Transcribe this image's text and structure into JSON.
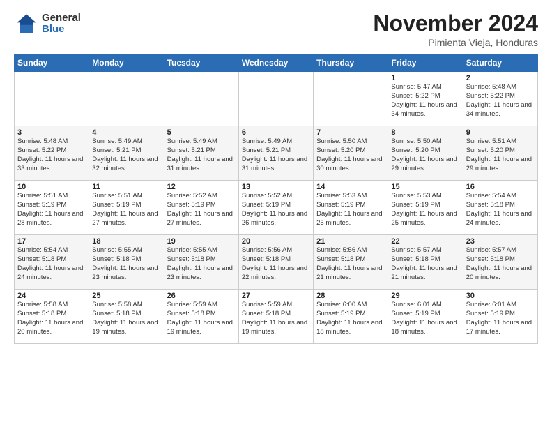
{
  "header": {
    "logo_general": "General",
    "logo_blue": "Blue",
    "month": "November 2024",
    "location": "Pimienta Vieja, Honduras"
  },
  "days_of_week": [
    "Sunday",
    "Monday",
    "Tuesday",
    "Wednesday",
    "Thursday",
    "Friday",
    "Saturday"
  ],
  "weeks": [
    [
      {
        "day": "",
        "sunrise": "",
        "sunset": "",
        "daylight": ""
      },
      {
        "day": "",
        "sunrise": "",
        "sunset": "",
        "daylight": ""
      },
      {
        "day": "",
        "sunrise": "",
        "sunset": "",
        "daylight": ""
      },
      {
        "day": "",
        "sunrise": "",
        "sunset": "",
        "daylight": ""
      },
      {
        "day": "",
        "sunrise": "",
        "sunset": "",
        "daylight": ""
      },
      {
        "day": "1",
        "sunrise": "Sunrise: 5:47 AM",
        "sunset": "Sunset: 5:22 PM",
        "daylight": "Daylight: 11 hours and 34 minutes."
      },
      {
        "day": "2",
        "sunrise": "Sunrise: 5:48 AM",
        "sunset": "Sunset: 5:22 PM",
        "daylight": "Daylight: 11 hours and 34 minutes."
      }
    ],
    [
      {
        "day": "3",
        "sunrise": "Sunrise: 5:48 AM",
        "sunset": "Sunset: 5:22 PM",
        "daylight": "Daylight: 11 hours and 33 minutes."
      },
      {
        "day": "4",
        "sunrise": "Sunrise: 5:49 AM",
        "sunset": "Sunset: 5:21 PM",
        "daylight": "Daylight: 11 hours and 32 minutes."
      },
      {
        "day": "5",
        "sunrise": "Sunrise: 5:49 AM",
        "sunset": "Sunset: 5:21 PM",
        "daylight": "Daylight: 11 hours and 31 minutes."
      },
      {
        "day": "6",
        "sunrise": "Sunrise: 5:49 AM",
        "sunset": "Sunset: 5:21 PM",
        "daylight": "Daylight: 11 hours and 31 minutes."
      },
      {
        "day": "7",
        "sunrise": "Sunrise: 5:50 AM",
        "sunset": "Sunset: 5:20 PM",
        "daylight": "Daylight: 11 hours and 30 minutes."
      },
      {
        "day": "8",
        "sunrise": "Sunrise: 5:50 AM",
        "sunset": "Sunset: 5:20 PM",
        "daylight": "Daylight: 11 hours and 29 minutes."
      },
      {
        "day": "9",
        "sunrise": "Sunrise: 5:51 AM",
        "sunset": "Sunset: 5:20 PM",
        "daylight": "Daylight: 11 hours and 29 minutes."
      }
    ],
    [
      {
        "day": "10",
        "sunrise": "Sunrise: 5:51 AM",
        "sunset": "Sunset: 5:19 PM",
        "daylight": "Daylight: 11 hours and 28 minutes."
      },
      {
        "day": "11",
        "sunrise": "Sunrise: 5:51 AM",
        "sunset": "Sunset: 5:19 PM",
        "daylight": "Daylight: 11 hours and 27 minutes."
      },
      {
        "day": "12",
        "sunrise": "Sunrise: 5:52 AM",
        "sunset": "Sunset: 5:19 PM",
        "daylight": "Daylight: 11 hours and 27 minutes."
      },
      {
        "day": "13",
        "sunrise": "Sunrise: 5:52 AM",
        "sunset": "Sunset: 5:19 PM",
        "daylight": "Daylight: 11 hours and 26 minutes."
      },
      {
        "day": "14",
        "sunrise": "Sunrise: 5:53 AM",
        "sunset": "Sunset: 5:19 PM",
        "daylight": "Daylight: 11 hours and 25 minutes."
      },
      {
        "day": "15",
        "sunrise": "Sunrise: 5:53 AM",
        "sunset": "Sunset: 5:19 PM",
        "daylight": "Daylight: 11 hours and 25 minutes."
      },
      {
        "day": "16",
        "sunrise": "Sunrise: 5:54 AM",
        "sunset": "Sunset: 5:18 PM",
        "daylight": "Daylight: 11 hours and 24 minutes."
      }
    ],
    [
      {
        "day": "17",
        "sunrise": "Sunrise: 5:54 AM",
        "sunset": "Sunset: 5:18 PM",
        "daylight": "Daylight: 11 hours and 24 minutes."
      },
      {
        "day": "18",
        "sunrise": "Sunrise: 5:55 AM",
        "sunset": "Sunset: 5:18 PM",
        "daylight": "Daylight: 11 hours and 23 minutes."
      },
      {
        "day": "19",
        "sunrise": "Sunrise: 5:55 AM",
        "sunset": "Sunset: 5:18 PM",
        "daylight": "Daylight: 11 hours and 23 minutes."
      },
      {
        "day": "20",
        "sunrise": "Sunrise: 5:56 AM",
        "sunset": "Sunset: 5:18 PM",
        "daylight": "Daylight: 11 hours and 22 minutes."
      },
      {
        "day": "21",
        "sunrise": "Sunrise: 5:56 AM",
        "sunset": "Sunset: 5:18 PM",
        "daylight": "Daylight: 11 hours and 21 minutes."
      },
      {
        "day": "22",
        "sunrise": "Sunrise: 5:57 AM",
        "sunset": "Sunset: 5:18 PM",
        "daylight": "Daylight: 11 hours and 21 minutes."
      },
      {
        "day": "23",
        "sunrise": "Sunrise: 5:57 AM",
        "sunset": "Sunset: 5:18 PM",
        "daylight": "Daylight: 11 hours and 20 minutes."
      }
    ],
    [
      {
        "day": "24",
        "sunrise": "Sunrise: 5:58 AM",
        "sunset": "Sunset: 5:18 PM",
        "daylight": "Daylight: 11 hours and 20 minutes."
      },
      {
        "day": "25",
        "sunrise": "Sunrise: 5:58 AM",
        "sunset": "Sunset: 5:18 PM",
        "daylight": "Daylight: 11 hours and 19 minutes."
      },
      {
        "day": "26",
        "sunrise": "Sunrise: 5:59 AM",
        "sunset": "Sunset: 5:18 PM",
        "daylight": "Daylight: 11 hours and 19 minutes."
      },
      {
        "day": "27",
        "sunrise": "Sunrise: 5:59 AM",
        "sunset": "Sunset: 5:18 PM",
        "daylight": "Daylight: 11 hours and 19 minutes."
      },
      {
        "day": "28",
        "sunrise": "Sunrise: 6:00 AM",
        "sunset": "Sunset: 5:19 PM",
        "daylight": "Daylight: 11 hours and 18 minutes."
      },
      {
        "day": "29",
        "sunrise": "Sunrise: 6:01 AM",
        "sunset": "Sunset: 5:19 PM",
        "daylight": "Daylight: 11 hours and 18 minutes."
      },
      {
        "day": "30",
        "sunrise": "Sunrise: 6:01 AM",
        "sunset": "Sunset: 5:19 PM",
        "daylight": "Daylight: 11 hours and 17 minutes."
      }
    ]
  ]
}
